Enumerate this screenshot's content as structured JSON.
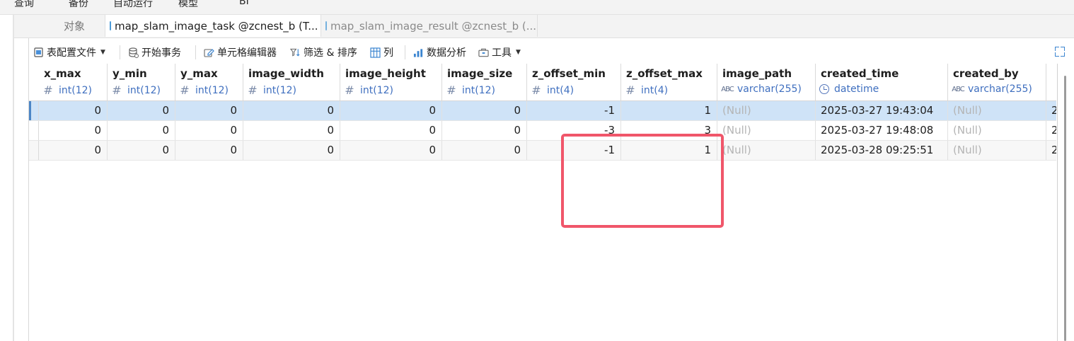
{
  "menu": [
    "查询",
    "备份",
    "自动运行",
    "模型",
    "BI"
  ],
  "tabs": {
    "objects": "对象",
    "active": "map_slam_image_task @zcnest_b (T...",
    "inactive": "map_slam_image_result @zcnest_b (..."
  },
  "toolbar": {
    "config_file": "表配置文件",
    "begin_transaction": "开始事务",
    "cell_editor": "单元格编辑器",
    "filter_sort": "筛选 & 排序",
    "columns": "列",
    "data_analysis": "数据分析",
    "tools": "工具"
  },
  "columns": [
    {
      "name": "x_max",
      "type": "int(12)",
      "icon": "hash-icon"
    },
    {
      "name": "y_min",
      "type": "int(12)",
      "icon": "hash-icon"
    },
    {
      "name": "y_max",
      "type": "int(12)",
      "icon": "hash-icon"
    },
    {
      "name": "image_width",
      "type": "int(12)",
      "icon": "hash-icon"
    },
    {
      "name": "image_height",
      "type": "int(12)",
      "icon": "hash-icon"
    },
    {
      "name": "image_size",
      "type": "int(12)",
      "icon": "hash-icon"
    },
    {
      "name": "z_offset_min",
      "type": "int(4)",
      "icon": "hash-icon"
    },
    {
      "name": "z_offset_max",
      "type": "int(4)",
      "icon": "hash-icon"
    },
    {
      "name": "image_path",
      "type": "varchar(255)",
      "icon": "text-type-icon"
    },
    {
      "name": "created_time",
      "type": "datetime",
      "icon": "clock-icon"
    },
    {
      "name": "created_by",
      "type": "varchar(255)",
      "icon": "text-type-icon"
    }
  ],
  "rows": [
    {
      "x_max": "0",
      "y_min": "0",
      "y_max": "0",
      "image_width": "0",
      "image_height": "0",
      "image_size": "0",
      "z_offset_min": "-1",
      "z_offset_max": "1",
      "image_path": "(Null)",
      "created_time": "2025-03-27 19:43:04",
      "created_by": "(Null)",
      "overflow": "2"
    },
    {
      "x_max": "0",
      "y_min": "0",
      "y_max": "0",
      "image_width": "0",
      "image_height": "0",
      "image_size": "0",
      "z_offset_min": "-3",
      "z_offset_max": "3",
      "image_path": "(Null)",
      "created_time": "2025-03-27 19:48:08",
      "created_by": "(Null)",
      "overflow": "2"
    },
    {
      "x_max": "0",
      "y_min": "0",
      "y_max": "0",
      "image_width": "0",
      "image_height": "0",
      "image_size": "0",
      "z_offset_min": "-1",
      "z_offset_max": "1",
      "image_path": "(Null)",
      "created_time": "2025-03-28 09:25:51",
      "created_by": "(Null)",
      "overflow": "2"
    }
  ],
  "colors": {
    "selected_row": "#cfe3f7",
    "type_text": "#3f6fbf",
    "null_text": "#b4b4b4",
    "annotation": "#f0566a"
  }
}
